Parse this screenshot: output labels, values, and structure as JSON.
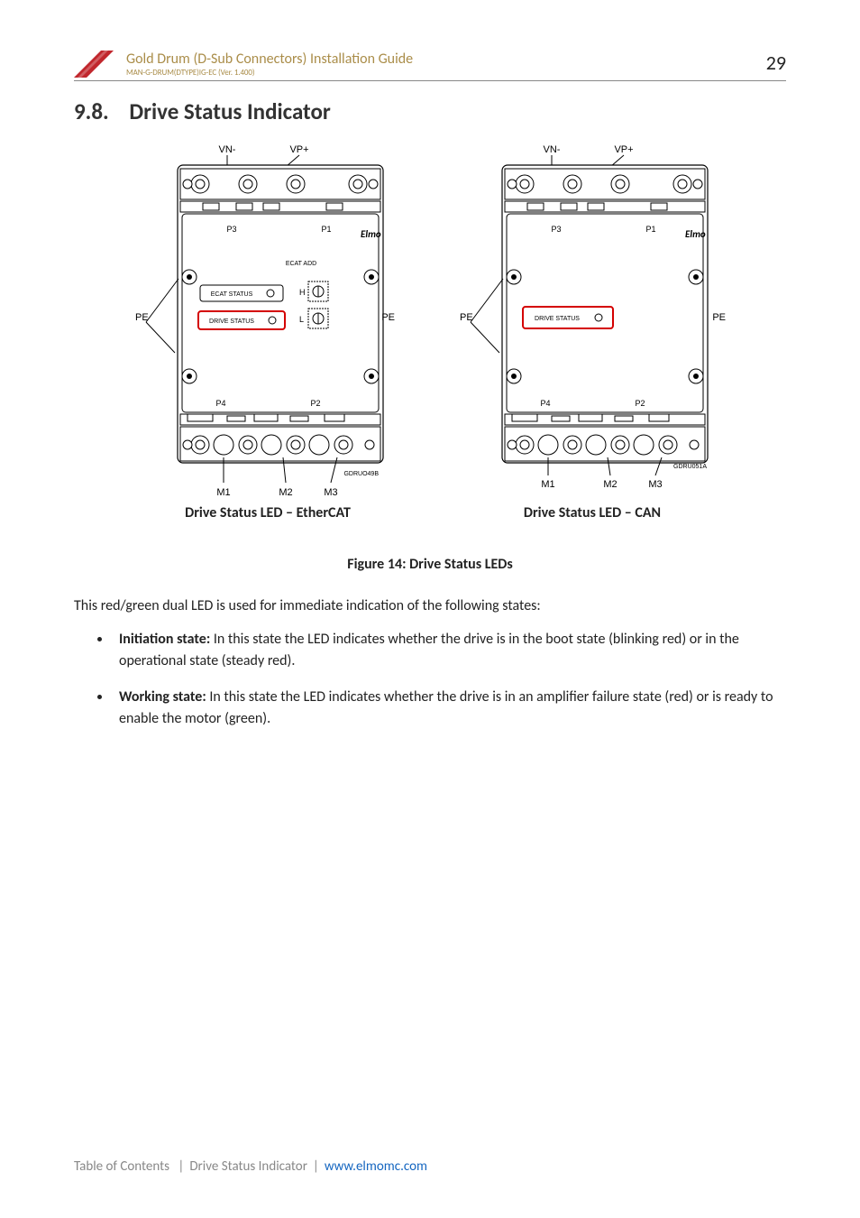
{
  "header": {
    "doc_title": "Gold Drum (D-Sub Connectors) Installation Guide",
    "doc_id": "MAN-G-DRUM(DTYPE)IG-EC (Ver. 1.400)",
    "page_number": "29"
  },
  "section": {
    "number": "9.8.",
    "title": "Drive Status Indicator"
  },
  "figure": {
    "left_caption": "Drive Status LED – EtherCAT",
    "right_caption": "Drive Status LED – CAN",
    "main_caption": "Figure 14: Drive Status LEDs",
    "labels": {
      "vn_minus": "VN-",
      "vp_plus": "VP+",
      "pe": "PE",
      "p1": "P1",
      "p2": "P2",
      "p3": "P3",
      "p4": "P4",
      "m1": "M1",
      "m2": "M2",
      "m3": "M3",
      "elmo": "Elmo",
      "ecat_add": "ECAT ADD",
      "ecat_status": "ECAT STATUS",
      "drive_status": "DRIVE STATUS",
      "h": "H",
      "l": "L",
      "gdru_left": "GDRUO49B",
      "gdru_right": "GDRU051A"
    }
  },
  "body": {
    "intro": "This red/green dual LED is used for immediate indication of the following states:",
    "bullets": [
      {
        "lead": "Initiation state:",
        "text": " In this state the LED indicates whether the drive is in the boot state (blinking red) or in the operational state (steady red)."
      },
      {
        "lead": "Working state:",
        "text": " In this state the LED indicates whether the drive is in an amplifier failure state (red) or is ready to enable the motor (green)."
      }
    ]
  },
  "footer": {
    "toc": "Table of Contents",
    "crumb": "Drive Status Indicator",
    "url": "www.elmomc.com"
  }
}
